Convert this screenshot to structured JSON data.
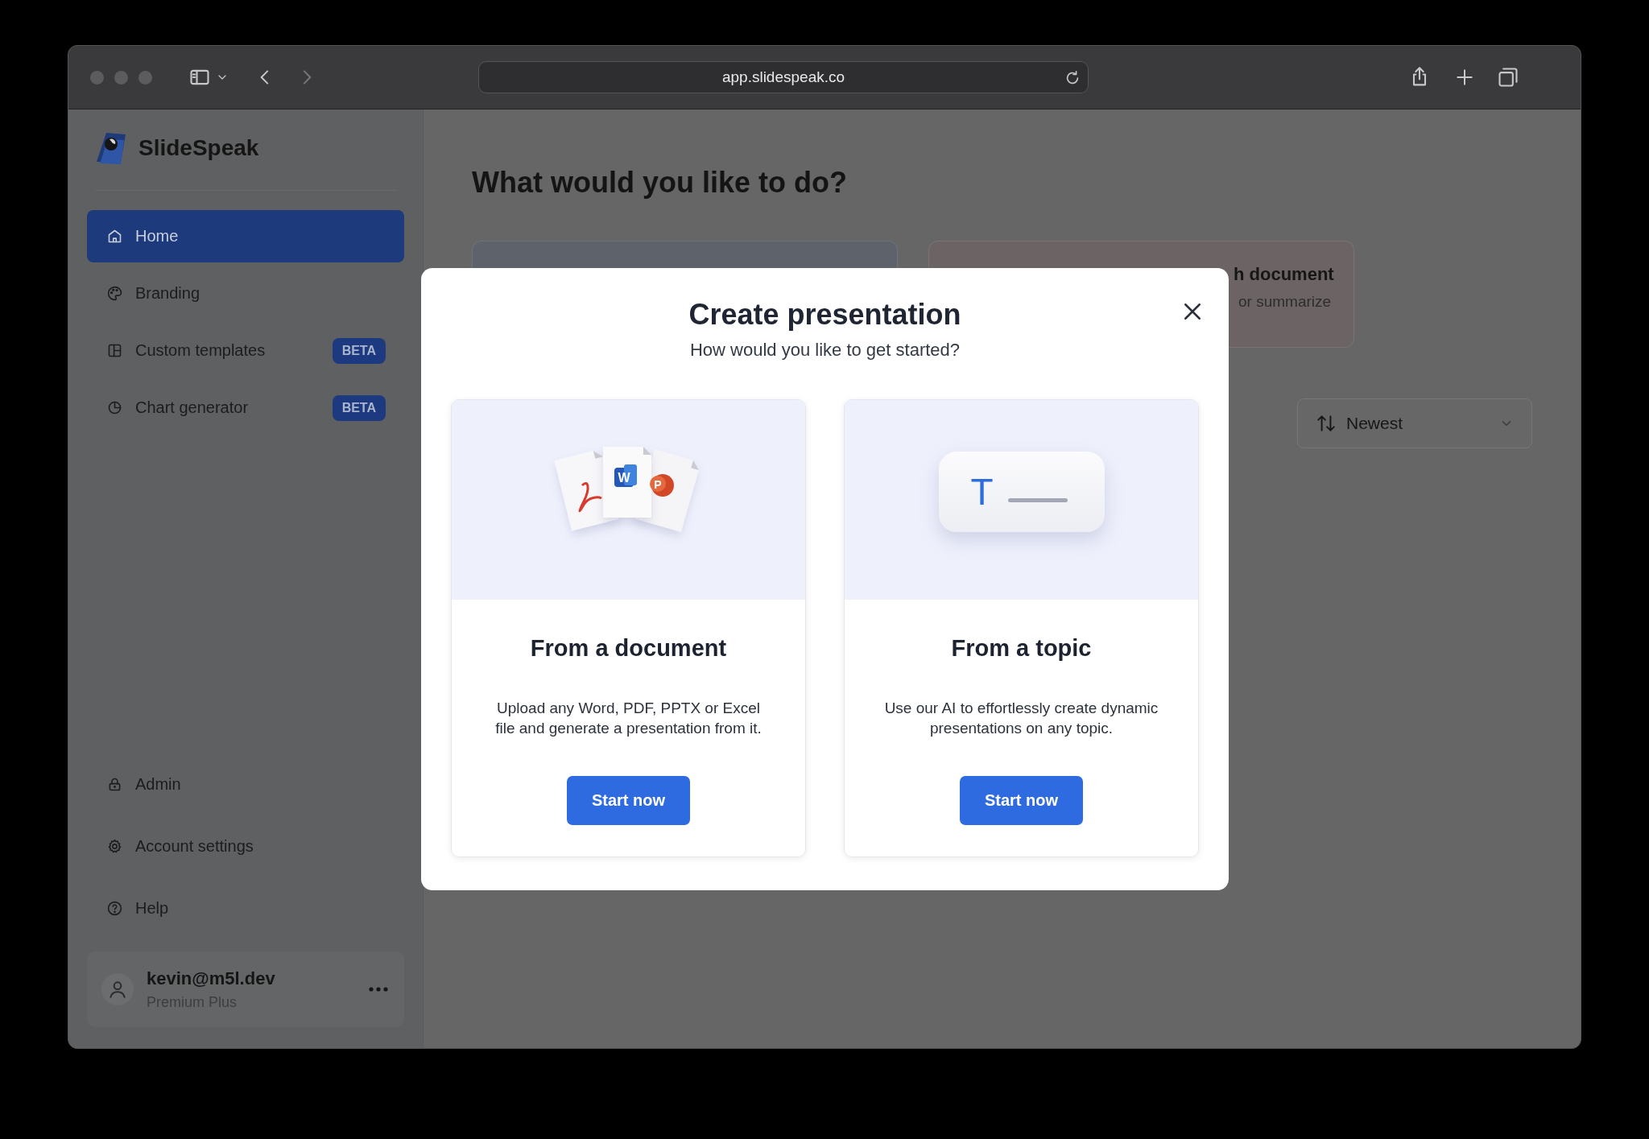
{
  "browser": {
    "url": "app.slidespeak.co"
  },
  "sidebar": {
    "brand": "SlideSpeak",
    "nav_items": [
      {
        "label": "Home",
        "selected": true
      },
      {
        "label": "Branding",
        "selected": false
      },
      {
        "label": "Custom templates",
        "selected": false,
        "badge": "BETA"
      },
      {
        "label": "Chart generator",
        "selected": false,
        "badge": "BETA"
      }
    ],
    "bottom_items": [
      {
        "label": "Admin"
      },
      {
        "label": "Account settings"
      },
      {
        "label": "Help"
      }
    ],
    "user": {
      "email": "kevin@m5l.dev",
      "plan": "Premium Plus"
    }
  },
  "main": {
    "heading": "What would you like to do?",
    "action_cards": [
      {
        "color": "#5e636b"
      },
      {
        "color": "#6c6464",
        "title": "h document",
        "subtitle": "or summarize"
      }
    ],
    "sort": {
      "label": "Newest"
    }
  },
  "modal": {
    "title": "Create presentation",
    "subtitle": "How would you like to get started?",
    "options": [
      {
        "kind": "document",
        "title": "From a document",
        "description": "Upload any Word, PDF, PPTX or Excel file and generate a presentation from it.",
        "button": "Start now",
        "marks": [
          "W",
          "P"
        ]
      },
      {
        "kind": "topic",
        "title": "From a topic",
        "description": "Use our AI to effortlessly create dynamic presentations on any topic.",
        "button": "Start now",
        "glyph": "T"
      }
    ]
  }
}
